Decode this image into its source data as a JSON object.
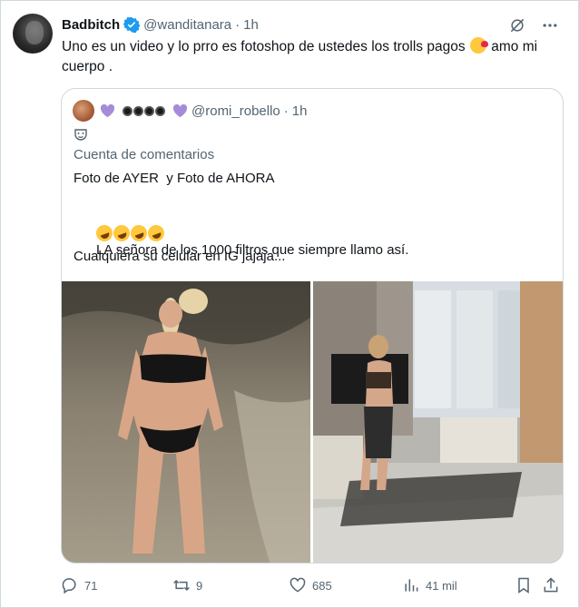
{
  "author": {
    "name": "Badbitch",
    "handle": "@wanditanara",
    "separator": "·",
    "time": "1h"
  },
  "tweet": {
    "text_part1": "Uno es un video y lo prro es fotoshop de ustedes los trolls pagos",
    "text_part2": "amo mi cuerpo ."
  },
  "quoted": {
    "handle": "@romi_robello",
    "separator": "·",
    "time": "1h",
    "community": "Cuenta de comentarios",
    "line1": "Foto de AYER  y Foto de AHORA",
    "line2": "LA señora de los 1000 filtros que siempre llamo así.",
    "line3": "Cualquiera su celular en IG jajaja..."
  },
  "actions": {
    "replies": "71",
    "reposts": "9",
    "likes": "685",
    "views": "41 mil"
  },
  "colors": {
    "verified": "#1d9bf0",
    "secondary_text": "#536471",
    "border": "#cfd9de",
    "purple_heart": "#a78bd8"
  },
  "icons": {
    "top_right": [
      "grok-icon",
      "more-icon"
    ],
    "action_bar": [
      "reply-icon",
      "repost-icon",
      "like-icon",
      "views-icon",
      "bookmark-icon",
      "share-icon"
    ]
  }
}
